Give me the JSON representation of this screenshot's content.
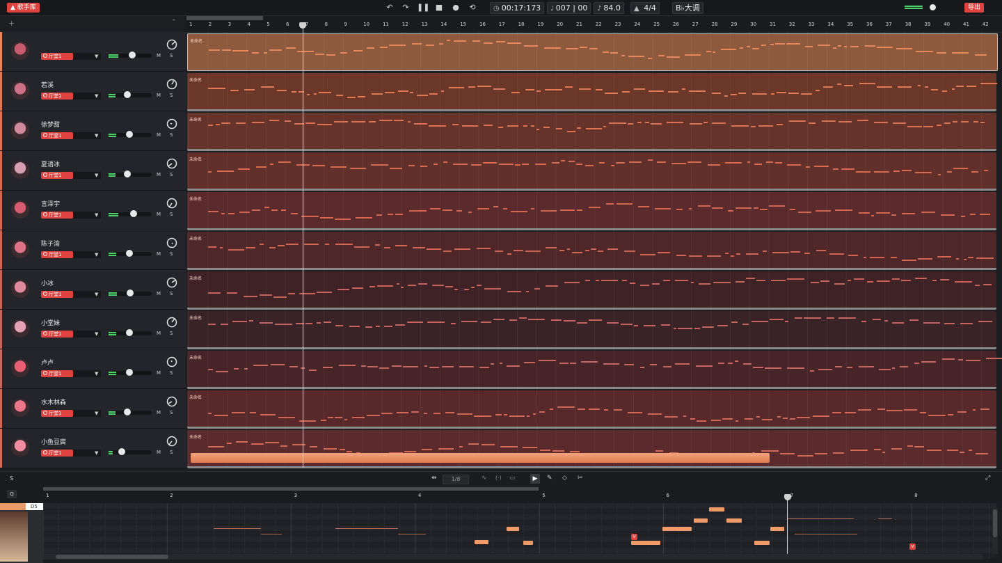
{
  "app": {
    "singer_library_label": "歌手库",
    "export_label": "导出"
  },
  "transport": {
    "time": "00:17:173",
    "position": "007 | 00",
    "tempo": "84.0",
    "time_signature": "4/4",
    "key": "B♭大调"
  },
  "ruler": {
    "bars": [
      "1",
      "2",
      "3",
      "4",
      "5",
      "6",
      "7",
      "8",
      "9",
      "10",
      "11",
      "12",
      "13",
      "14",
      "15",
      "16",
      "17",
      "18",
      "19",
      "20",
      "21",
      "22",
      "23",
      "24",
      "25",
      "26",
      "27",
      "28",
      "29",
      "30",
      "31",
      "32",
      "33",
      "34",
      "35",
      "36",
      "37",
      "38",
      "39",
      "40",
      "41",
      "42"
    ]
  },
  "clip_label": "未命名",
  "engine_label": "厅堂1",
  "mute_label": "M",
  "solo_label": "S",
  "tracks": [
    {
      "name": "",
      "color": "#e9875a",
      "lane_color": "#8e5a3e",
      "volume": 0.45
    },
    {
      "name": "若溪",
      "color": "#e07a55",
      "lane_color": "#6a3728",
      "volume": 0.33
    },
    {
      "name": "徐梦甜",
      "color": "#de7353",
      "lane_color": "#66332a",
      "volume": 0.38
    },
    {
      "name": "夏语冰",
      "color": "#d86a50",
      "lane_color": "#62302a",
      "volume": 0.33
    },
    {
      "name": "言泽宇",
      "color": "#d46650",
      "lane_color": "#5b2a2c",
      "volume": 0.48
    },
    {
      "name": "陈子渝",
      "color": "#cf6552",
      "lane_color": "#4f2728",
      "volume": 0.38
    },
    {
      "name": "小冰",
      "color": "#c8635a",
      "lane_color": "#3f2226",
      "volume": 0.4
    },
    {
      "name": "小堂妹",
      "color": "#c66460",
      "lane_color": "#3a2327",
      "volume": 0.38
    },
    {
      "name": "卢卢",
      "color": "#c86660",
      "lane_color": "#472428",
      "volume": 0.38
    },
    {
      "name": "水木林森",
      "color": "#d06855",
      "lane_color": "#57292a",
      "volume": 0.33
    },
    {
      "name": "小鱼豆腐",
      "color": "#d36a56",
      "lane_color": "#5a2a2c",
      "volume": 0.2
    }
  ],
  "editor": {
    "track_short": "S",
    "quantize": "1/8",
    "q_label": "Q",
    "pitch_label": "D5",
    "bars": [
      "1",
      "2",
      "3",
      "4",
      "5",
      "6",
      "7",
      "8"
    ]
  }
}
